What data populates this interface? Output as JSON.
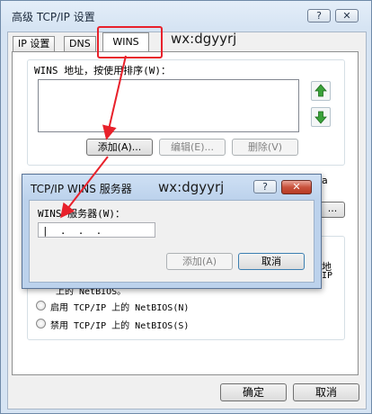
{
  "main_window": {
    "title": "高级 TCP/IP 设置",
    "help_button": "?",
    "close_button": "✕",
    "tabs": [
      {
        "label": "IP 设置"
      },
      {
        "label": "DNS"
      },
      {
        "label": "WINS"
      }
    ],
    "active_tab": "WINS",
    "watermark": "wx:dgyyrj",
    "wins_group": {
      "label": "WINS 地址，按使用排序(W)：",
      "add_button": "添加(A)...",
      "edit_button": "编辑(E)...",
      "delete_button": "删除(V)"
    },
    "lmhosts_trailing": "a",
    "lmhosts_button": "...",
    "netbios": {
      "partial_right_1": "地",
      "partial_right_2": "IP",
      "partial_left": "上的 NetBIOS。",
      "option_enable": "启用 TCP/IP 上的 NetBIOS(N)",
      "option_disable": "禁用 TCP/IP 上的 NetBIOS(S)"
    },
    "ok_button": "确定",
    "cancel_button": "取消"
  },
  "dialog": {
    "title": "TCP/IP WINS 服务器",
    "watermark": "wx:dgyyrj",
    "help_button": "?",
    "close_button": "✕",
    "server_label": "WINS 服务器(W)：",
    "ip_value": "|  .  .  .",
    "add_button": "添加(A)",
    "cancel_button": "取消"
  },
  "annotation_color": "#e8212b"
}
